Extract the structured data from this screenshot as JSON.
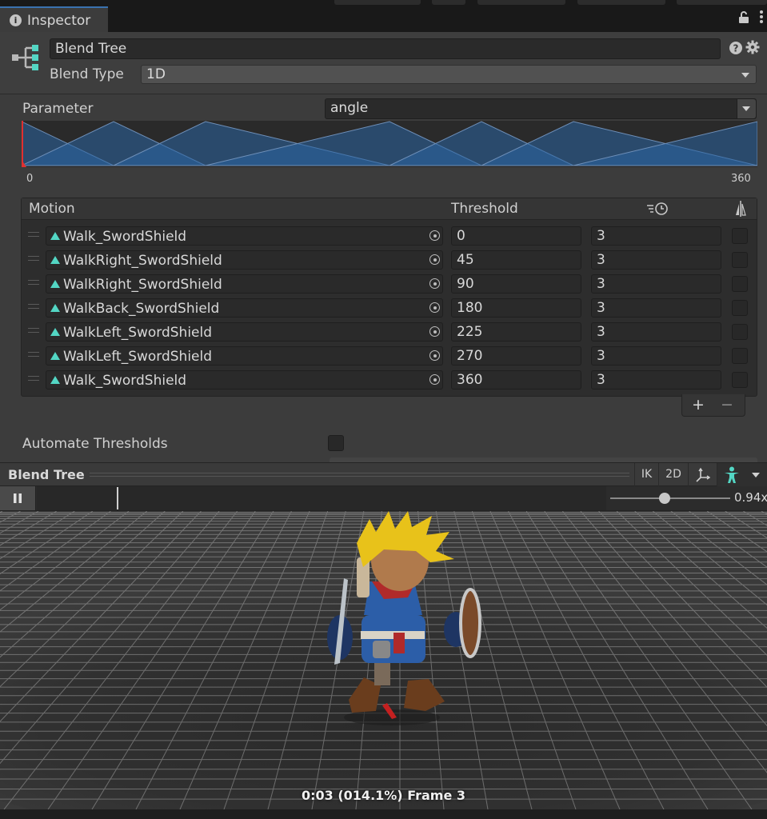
{
  "window": {
    "tab_label": "Inspector",
    "title_field": "Blend Tree",
    "blend_type_label": "Blend Type",
    "blend_type_value": "1D"
  },
  "parameter": {
    "label": "Parameter",
    "value": "angle",
    "range_min": "0",
    "range_max": "360",
    "current_value": 0
  },
  "motion_list": {
    "col_motion": "Motion",
    "col_threshold": "Threshold",
    "rows": [
      {
        "motion": "Walk_SwordShield",
        "threshold": "0",
        "speed": "3",
        "mirror": false
      },
      {
        "motion": "WalkRight_SwordShield",
        "threshold": "45",
        "speed": "3",
        "mirror": false
      },
      {
        "motion": "WalkRight_SwordShield",
        "threshold": "90",
        "speed": "3",
        "mirror": false
      },
      {
        "motion": "WalkBack_SwordShield",
        "threshold": "180",
        "speed": "3",
        "mirror": false
      },
      {
        "motion": "WalkLeft_SwordShield",
        "threshold": "225",
        "speed": "3",
        "mirror": false
      },
      {
        "motion": "WalkLeft_SwordShield",
        "threshold": "270",
        "speed": "3",
        "mirror": false
      },
      {
        "motion": "Walk_SwordShield",
        "threshold": "360",
        "speed": "3",
        "mirror": false
      }
    ],
    "add_label": "+",
    "remove_label": "−"
  },
  "automate_thresholds": {
    "label": "Automate Thresholds",
    "checked": false
  },
  "preview": {
    "title": "Blend Tree",
    "ik_label": "IK",
    "mode_2d_label": "2D",
    "speed_value": "0.94x",
    "speed_fraction": 0.45,
    "timeline_position": 0.141,
    "caption": "0:03 (014.1%) Frame 3"
  },
  "colors": {
    "accent_blue": "#3a72b0",
    "graph_fill": "#2a64a3",
    "clip_icon": "#53d6c4",
    "panel_bg": "#3c3c3c",
    "field_bg": "#2a2a2a"
  },
  "icons": [
    "info-icon",
    "lock-icon",
    "more-options-icon",
    "blend-tree-icon",
    "help-icon",
    "settings-gear-icon",
    "animation-clip-icon",
    "object-picker-icon",
    "time-scale-icon",
    "mirror-icon",
    "pause-icon",
    "pivot-icon",
    "avatar-icon"
  ]
}
